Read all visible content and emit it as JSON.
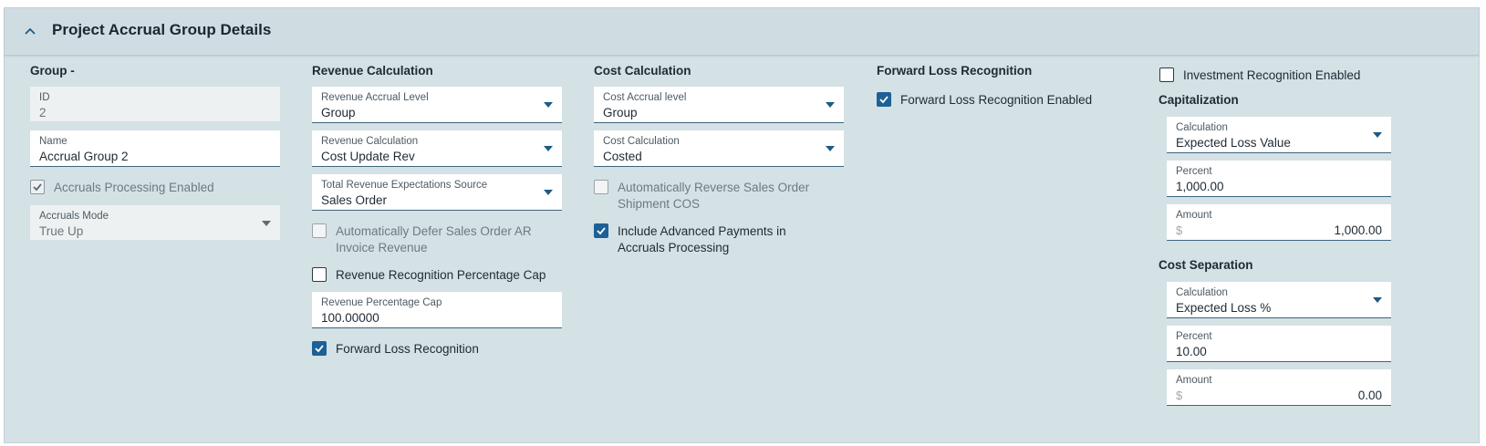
{
  "header": {
    "title": "Project Accrual Group Details"
  },
  "group": {
    "title": "Group -",
    "id_label": "ID",
    "id_value": "2",
    "name_label": "Name",
    "name_value": "Accrual Group 2",
    "accruals_processing_label": "Accruals Processing Enabled",
    "accruals_processing_checked": true,
    "accruals_mode_label": "Accruals Mode",
    "accruals_mode_value": "True Up"
  },
  "revenue": {
    "title": "Revenue Calculation",
    "accrual_level_label": "Revenue Accrual Level",
    "accrual_level_value": "Group",
    "calculation_label": "Revenue Calculation",
    "calculation_value": "Cost Update Rev",
    "expectations_label": "Total Revenue Expectations Source",
    "expectations_value": "Sales Order",
    "auto_defer_line1": "Automatically Defer Sales Order AR",
    "auto_defer_line2": "Invoice Revenue",
    "auto_defer_checked": false,
    "pct_cap_check_label": "Revenue Recognition Percentage Cap",
    "pct_cap_checked": false,
    "pct_cap_label": "Revenue Percentage Cap",
    "pct_cap_value": "100.00000",
    "forward_loss_label": "Forward Loss Recognition",
    "forward_loss_checked": true
  },
  "cost": {
    "title": "Cost Calculation",
    "accrual_level_label": "Cost Accrual level",
    "accrual_level_value": "Group",
    "calculation_label": "Cost Calculation",
    "calculation_value": "Costed",
    "auto_reverse_line1": "Automatically Reverse Sales Order",
    "auto_reverse_line2": "Shipment COS",
    "auto_reverse_checked": false,
    "advanced_payments_line1": "Include Advanced Payments in",
    "advanced_payments_line2": "Accruals Processing",
    "advanced_payments_checked": true
  },
  "forward_loss": {
    "title": "Forward Loss Recognition",
    "enabled_label": "Forward Loss Recognition Enabled",
    "enabled_checked": true
  },
  "investment": {
    "label": "Investment Recognition Enabled",
    "checked": false
  },
  "capitalization": {
    "title": "Capitalization",
    "calculation_label": "Calculation",
    "calculation_value": "Expected Loss Value",
    "percent_label": "Percent",
    "percent_value": "1,000.00",
    "amount_label": "Amount",
    "amount_prefix": "$",
    "amount_value": "1,000.00"
  },
  "cost_separation": {
    "title": "Cost Separation",
    "calculation_label": "Calculation",
    "calculation_value": "Expected Loss %",
    "percent_label": "Percent",
    "percent_value": "10.00",
    "amount_label": "Amount",
    "amount_prefix": "$",
    "amount_value": "0.00"
  },
  "colors": {
    "accent": "#1d6096",
    "panel_bg": "#d4e1e5",
    "underline": "#3d6480"
  }
}
